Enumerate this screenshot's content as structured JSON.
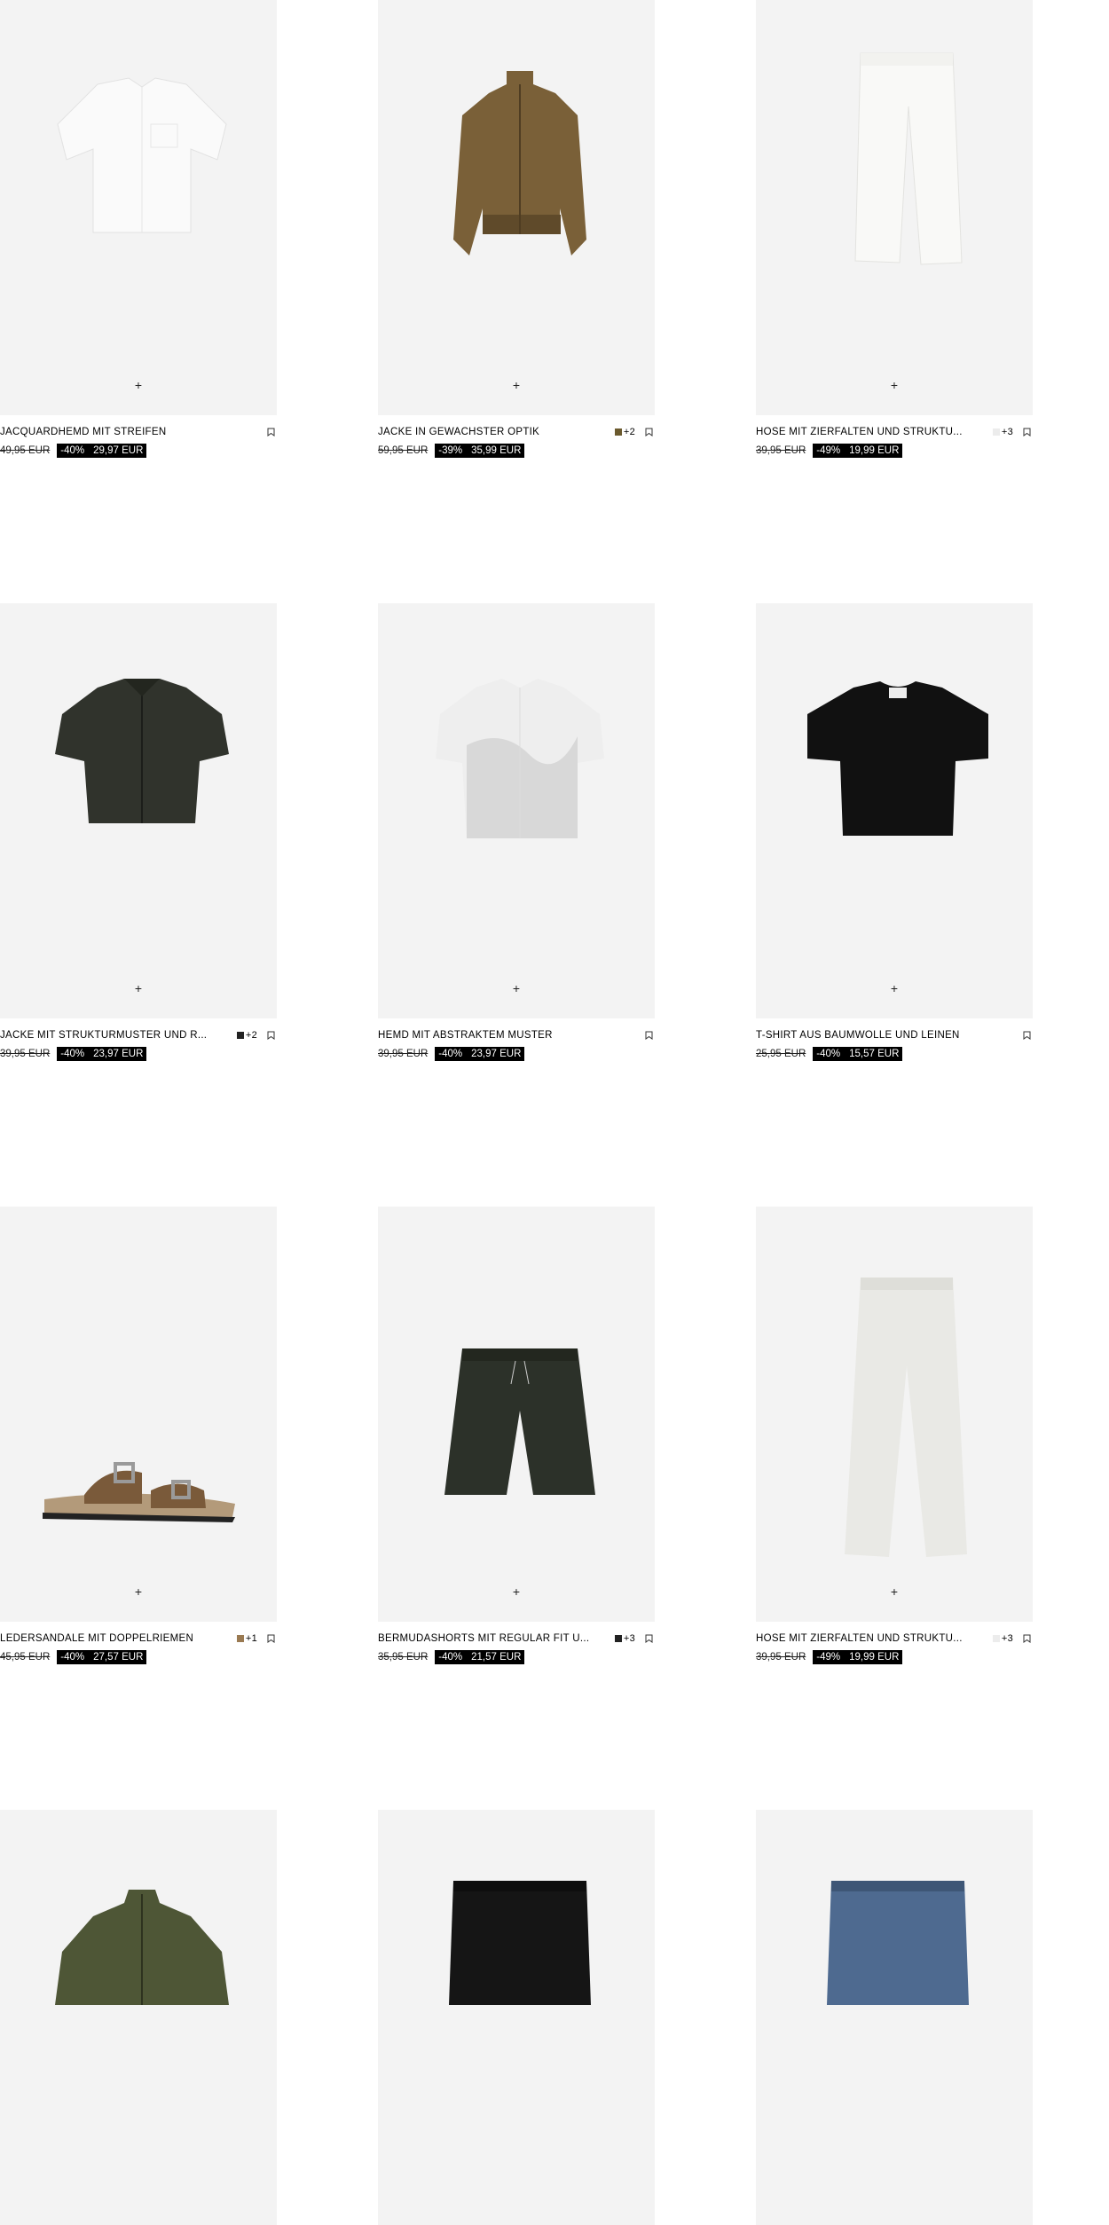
{
  "products": [
    {
      "name": "JACQUARDHEMD MIT STREIFEN",
      "old_price": "49,95 EUR",
      "discount": "-40%",
      "price": "29,97 EUR",
      "colors": null,
      "art": "shirt-white"
    },
    {
      "name": "JACKE IN GEWACHSTER OPTIK",
      "old_price": "59,95 EUR",
      "discount": "-39%",
      "price": "35,99 EUR",
      "colors": {
        "swatch": "#6b5a2e",
        "more": "+2"
      },
      "art": "jacket-brown"
    },
    {
      "name": "HOSE MIT ZIERFALTEN UND STRUKTU...",
      "old_price": "39,95 EUR",
      "discount": "-49%",
      "price": "19,99 EUR",
      "colors": {
        "swatch": "#ececec",
        "more": "+3"
      },
      "art": "pants-white"
    },
    {
      "name": "JACKE MIT STRUKTURMUSTER UND R...",
      "old_price": "39,95 EUR",
      "discount": "-40%",
      "price": "23,97 EUR",
      "colors": {
        "swatch": "#222",
        "more": "+2"
      },
      "art": "jacket-zip-dark"
    },
    {
      "name": "HEMD MIT ABSTRAKTEM MUSTER",
      "old_price": "39,95 EUR",
      "discount": "-40%",
      "price": "23,97 EUR",
      "colors": null,
      "art": "shirt-abstract"
    },
    {
      "name": "T-SHIRT AUS BAUMWOLLE UND LEINEN",
      "old_price": "25,95 EUR",
      "discount": "-40%",
      "price": "15,57 EUR",
      "colors": null,
      "art": "tshirt-black"
    },
    {
      "name": "LEDERSANDALE MIT DOPPELRIEMEN",
      "old_price": "45,95 EUR",
      "discount": "-40%",
      "price": "27,57 EUR",
      "colors": {
        "swatch": "#9a7a52",
        "more": "+1"
      },
      "art": "sandal"
    },
    {
      "name": "BERMUDASHORTS MIT REGULAR FIT U...",
      "old_price": "35,95 EUR",
      "discount": "-40%",
      "price": "21,57 EUR",
      "colors": {
        "swatch": "#222",
        "more": "+3"
      },
      "art": "shorts-dark"
    },
    {
      "name": "HOSE MIT ZIERFALTEN UND STRUKTU...",
      "old_price": "39,95 EUR",
      "discount": "-49%",
      "price": "19,99 EUR",
      "colors": {
        "swatch": "#ececec",
        "more": "+3"
      },
      "art": "pants-cream"
    },
    {
      "name": "",
      "old_price": "",
      "discount": "",
      "price": "",
      "colors": null,
      "art": "jacket-olive"
    },
    {
      "name": "",
      "old_price": "",
      "discount": "",
      "price": "",
      "colors": null,
      "art": "shorts-black"
    },
    {
      "name": "",
      "old_price": "",
      "discount": "",
      "price": "",
      "colors": null,
      "art": "shorts-denim"
    }
  ],
  "icons": {
    "add": "plus-icon",
    "bookmark": "bookmark-icon"
  }
}
